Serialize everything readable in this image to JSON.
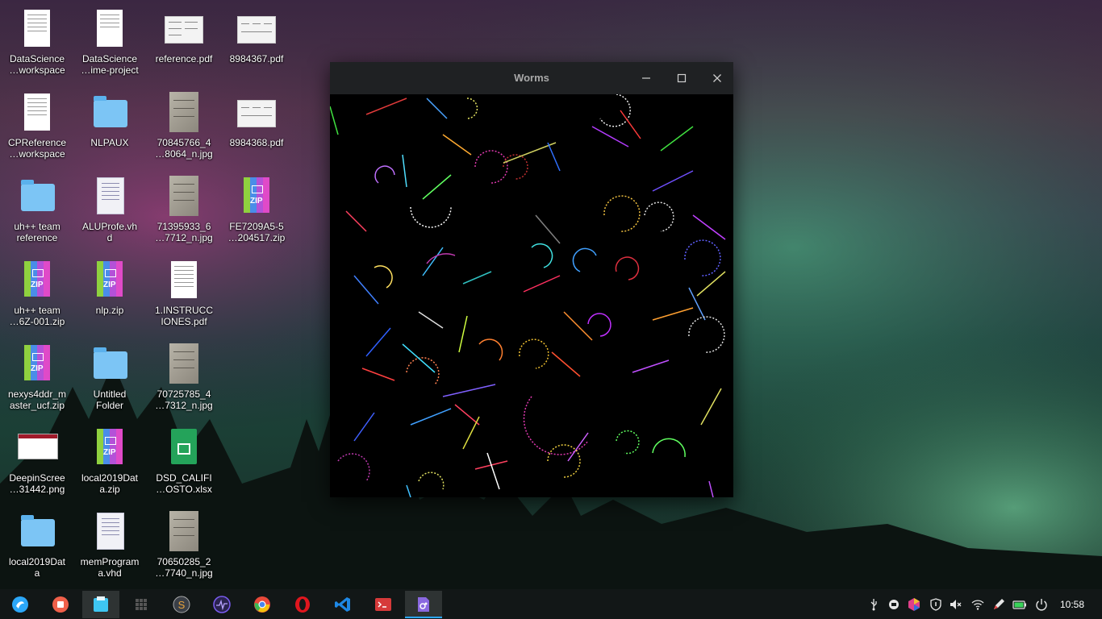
{
  "desktop": {
    "icons": [
      {
        "label": "DataScience\n…workspace"
      },
      {
        "label": "DataScience\n…ime-project"
      },
      {
        "label": "reference.pdf"
      },
      {
        "label": "8984367.pdf"
      },
      {
        "label": "CPReference\n…workspace"
      },
      {
        "label": "NLPAUX"
      },
      {
        "label": "70845766_4\n…8064_n.jpg"
      },
      {
        "label": "8984368.pdf"
      },
      {
        "label": "uh++ team\nreference"
      },
      {
        "label": "ALUProfe.vh\nd"
      },
      {
        "label": "71395933_6\n…7712_n.jpg"
      },
      {
        "label": "FE7209A5-5\n…204517.zip"
      },
      {
        "label": "uh++ team\n…6Z-001.zip"
      },
      {
        "label": "nlp.zip"
      },
      {
        "label": "1.INSTRUCC\nIONES.pdf"
      },
      {
        "label": "nexys4ddr_m\naster_ucf.zip"
      },
      {
        "label": "Untitled\nFolder"
      },
      {
        "label": "70725785_4\n…7312_n.jpg"
      },
      {
        "label": "DeepinScree\n…31442.png"
      },
      {
        "label": "local2019Dat\na.zip"
      },
      {
        "label": "DSD_CALIFI\n…OSTO.xlsx"
      },
      {
        "label": "local2019Dat\na"
      },
      {
        "label": "memProgram\na.vhd"
      },
      {
        "label": "70650285_2\n…7740_n.jpg"
      }
    ],
    "zip_badge": "ZIP"
  },
  "window": {
    "title": "Worms",
    "minimize_icon": "minimize-icon",
    "maximize_icon": "maximize-icon",
    "close_icon": "close-icon"
  },
  "taskbar": {
    "apps": [
      {
        "name": "launcher-icon",
        "color": "#2ca7f8"
      },
      {
        "name": "screen-recorder-icon",
        "color": "#f0604a"
      },
      {
        "name": "file-manager-icon",
        "color": "#3ec6f2"
      },
      {
        "name": "app-grid-icon",
        "color": "#555555"
      },
      {
        "name": "sublime-text-icon",
        "color": "#e8a33d"
      },
      {
        "name": "system-monitor-icon",
        "color": "#7a5cf0"
      },
      {
        "name": "chrome-icon",
        "color": "#e9493a"
      },
      {
        "name": "opera-icon",
        "color": "#e0161e"
      },
      {
        "name": "vscode-icon",
        "color": "#1e88e5"
      },
      {
        "name": "terminal-icon",
        "color": "#d63a3a"
      },
      {
        "name": "worms-app-icon",
        "color": "#8a68e0"
      }
    ],
    "tray": [
      "usb-icon",
      "notification-icon",
      "color-app-icon",
      "shield-icon",
      "volume-muted-icon",
      "wifi-icon",
      "pen-icon",
      "battery-icon",
      "power-icon"
    ],
    "clock": "10:58"
  }
}
